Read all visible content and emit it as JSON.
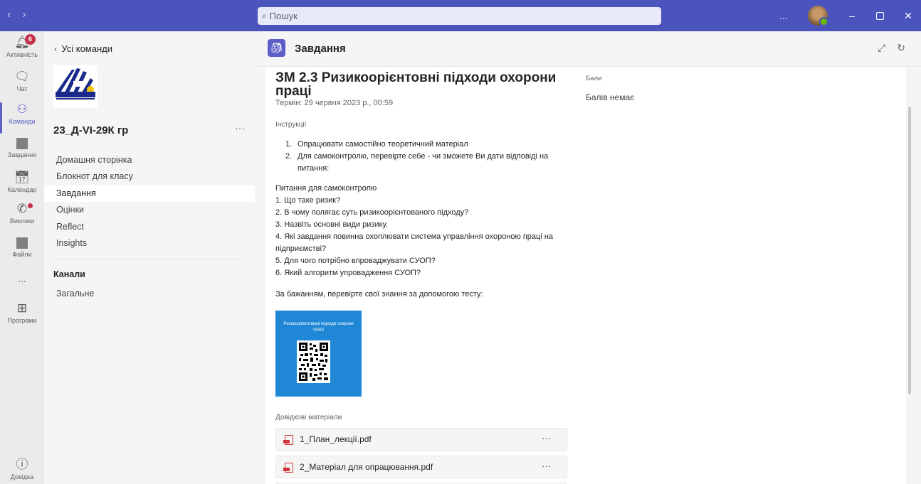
{
  "titlebar": {
    "search_placeholder": "Пошук",
    "more": "...",
    "minimize": "–",
    "close": "✕"
  },
  "rail": {
    "items": [
      {
        "label": "Активність",
        "badge": "6"
      },
      {
        "label": "Чат"
      },
      {
        "label": "Команди"
      },
      {
        "label": "Завдання"
      },
      {
        "label": "Календар"
      },
      {
        "label": "Виклики"
      },
      {
        "label": "Файли"
      },
      {
        "label": "..."
      },
      {
        "label": "Програми"
      },
      {
        "label": "Довідка"
      }
    ]
  },
  "team": {
    "back_label": "Усі команди",
    "logo_text": "КПК КУРСИ З ОХОРОНИ ПРАЦІ",
    "name": "23_Д-VI-29К гр",
    "more": "···",
    "nav": [
      "Домашня сторінка",
      "Блокнот для класу",
      "Завдання",
      "Оцінки",
      "Reflect",
      "Insights"
    ],
    "channels_title": "Канали",
    "channels": [
      "Загальне"
    ]
  },
  "main": {
    "app_title": "Завдання"
  },
  "assignment": {
    "title": "ЗМ 2.3 Ризикоорієнтовні підходи охорони праці",
    "due": "Термін: 29 червня 2023 р., 00:59",
    "points_label": "Бали",
    "points_value": "Балів немає",
    "instructions_label": "Інструкції",
    "steps": [
      {
        "num": "1.",
        "text": "Опрацювати самостійно теоретичний матеріал"
      },
      {
        "num": "2.",
        "text": "Для самоконтролю, перевірте себе - чи зможете Ви дати відповіді на питання:"
      }
    ],
    "questions": [
      "Питання для самоконтролю",
      "1. Що таке ризик?",
      "2. В чому полягає суть ризикоорієнтованого підходу?",
      "3. Назвіть основні види ризику.",
      "4. Які завдання повинна охоплювати система управління охороною праці на підприємстві?",
      "5. Для чого потрібно впроваджувати СУОП?",
      "6. Який алгоритм упровадження СУОП?"
    ],
    "test_note": "За бажанням, перевірте свої знання за допомогою тесту:",
    "qr_title": "Ризикоорієнтовані підходи охорони праці",
    "references_label": "Довідкові матеріали",
    "files": [
      {
        "name": "1_План_лекції.pdf",
        "more": "···"
      },
      {
        "name": "2_Матеріал для опрацювання.pdf",
        "more": "···"
      }
    ]
  }
}
